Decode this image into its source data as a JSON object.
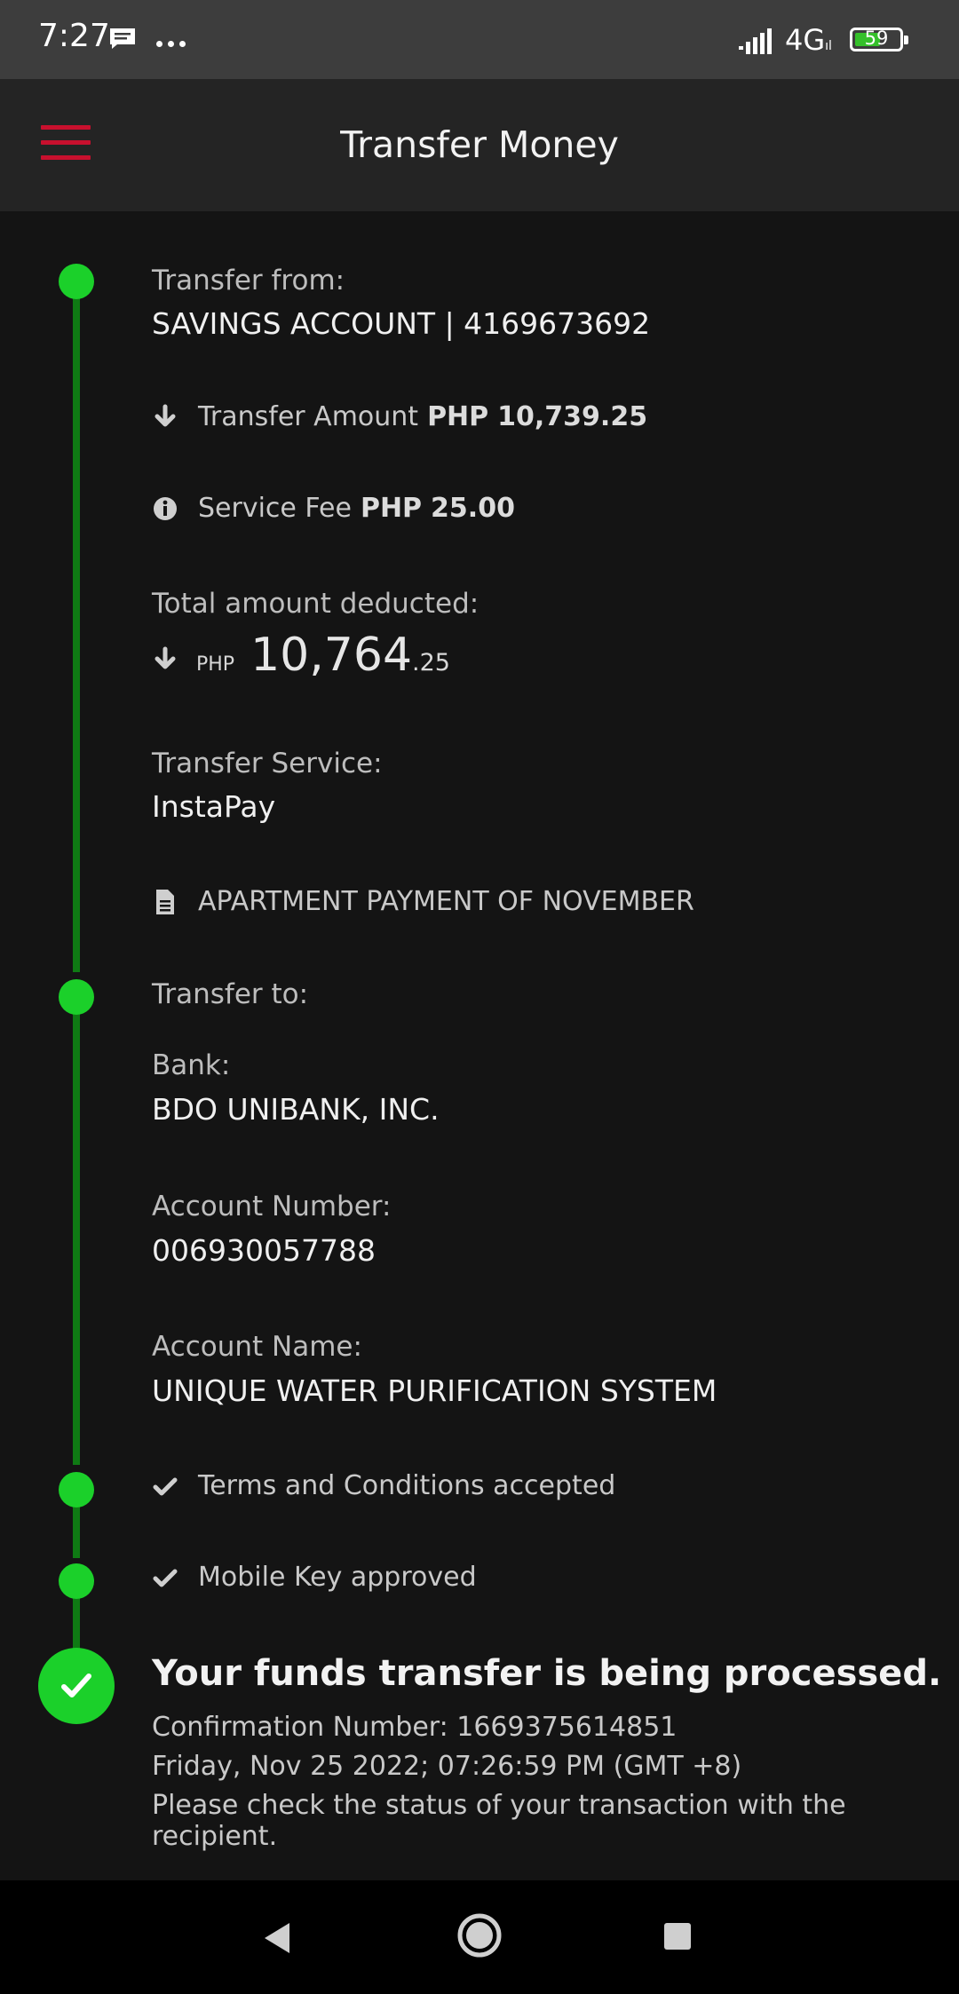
{
  "status_bar": {
    "time": "7:27",
    "network": "4G",
    "network_sub": "ıl",
    "battery": "59",
    "battery_level": 0.59
  },
  "header": {
    "title": "Transfer Money",
    "accent_color": "#c8102e"
  },
  "transfer_from": {
    "label": "Transfer from:",
    "value": "SAVINGS ACCOUNT | 4169673692"
  },
  "amounts": {
    "transfer_label": "Transfer Amount",
    "transfer_currency": "PHP",
    "transfer_value": "10,739.25",
    "fee_label": "Service Fee",
    "fee_currency": "PHP",
    "fee_value": "25.00",
    "total_label": "Total amount deducted:",
    "total_currency": "PHP",
    "total_whole": "10,764",
    "total_decimal": ".25"
  },
  "service": {
    "label": "Transfer Service:",
    "value": "InstaPay"
  },
  "note": "APARTMENT PAYMENT OF NOVEMBER",
  "transfer_to": {
    "label": "Transfer to:",
    "bank_label": "Bank:",
    "bank_value": "BDO UNIBANK, INC.",
    "account_number_label": "Account Number:",
    "account_number_value": "006930057788",
    "account_name_label": "Account Name:",
    "account_name_value": "UNIQUE WATER PURIFICATION SYSTEM"
  },
  "steps": {
    "terms": "Terms and Conditions accepted",
    "mobile_key": "Mobile Key approved"
  },
  "result": {
    "title": "Your funds transfer is being processed.",
    "confirmation": "Confirmation Number: 1669375614851",
    "datetime": "Friday, Nov 25 2022; 07:26:59 PM (GMT +8)",
    "message": "Please check the status of your transaction with the recipient."
  },
  "colors": {
    "timeline_dot": "#1bd02a",
    "timeline_line": "#0f7a14",
    "background": "#141414"
  }
}
